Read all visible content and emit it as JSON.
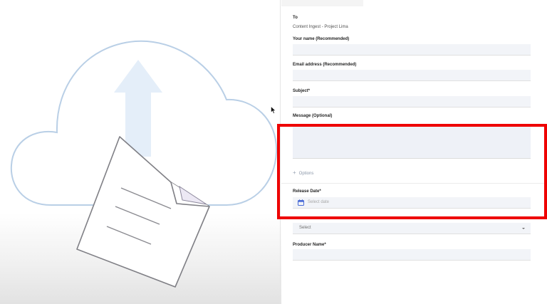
{
  "form": {
    "to_label": "To",
    "to_value": "Content Ingest - Project Lima",
    "name_label": "Your name (Recommended)",
    "email_label": "Email address (Recommended)",
    "subject_label": "Subject*",
    "message_label": "Message (Optional)",
    "options_label": "Options",
    "release_date_label": "Release Date*",
    "release_date_placeholder": "Select date",
    "select_value": "Select",
    "producer_label": "Producer Name*"
  },
  "icons": {
    "upload": "cloud-upload-icon",
    "document": "document-icon",
    "calendar": "calendar-icon",
    "chevron": "chevron-down-icon",
    "plus": "plus-icon",
    "cursor": "mouse-cursor"
  },
  "colors": {
    "highlight": "#ee0000",
    "cloud_stroke": "#b9cfe6",
    "arrow_fill": "#e4eef9",
    "field_bg": "#f2f4f8",
    "calendar": "#4a6bd6"
  }
}
